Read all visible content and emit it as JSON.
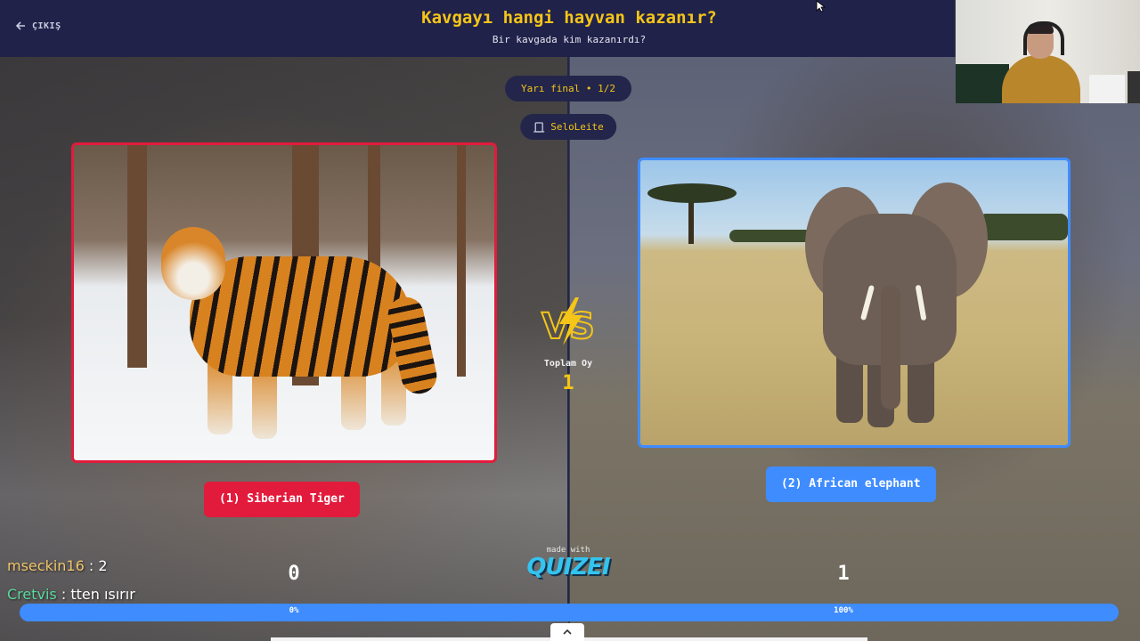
{
  "header": {
    "exit_label": "ÇIKIŞ",
    "title": "Kavgayı hangi hayvan kazanır?",
    "subtitle": "Bir kavgada kim kazanırdı?"
  },
  "round": {
    "label": "Yarı final • 1/2"
  },
  "user": {
    "name": "SeloLeite"
  },
  "left": {
    "name": "(1) Siberian Tiger",
    "votes": "0",
    "percent_label": "0%",
    "percent": 0,
    "color": "#e21b3c"
  },
  "right": {
    "name": "(2) African elephant",
    "votes": "1",
    "percent_label": "100%",
    "percent": 100,
    "color": "#3f8cff"
  },
  "center": {
    "total_label": "Toplam Oy",
    "total_value": "1"
  },
  "footer": {
    "made_with": "made with",
    "logo": "QUIZEI"
  },
  "chat": [
    {
      "user": "mseckin16",
      "message": " : 2"
    },
    {
      "user": "Cretvis",
      "message": " : tten ısırır"
    }
  ],
  "colors": {
    "accent": "#f5c518",
    "navy": "#21224a"
  }
}
